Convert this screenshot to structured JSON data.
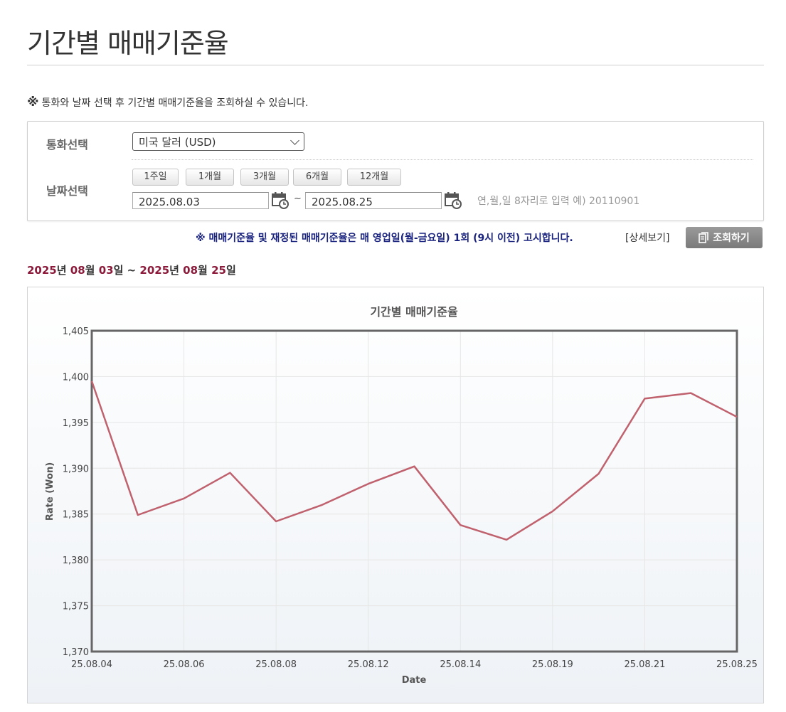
{
  "page": {
    "title": "기간별 매매기준율",
    "notice_mark": "※",
    "notice": "통화와 날짜 선택 후 기간별 매매기준율을 조회하실 수 있습니다."
  },
  "filter": {
    "currency_label": "통화선택",
    "currency_value": "미국 달러 (USD)",
    "date_label": "날짜선택",
    "period_buttons": [
      "1주일",
      "1개월",
      "3개월",
      "6개월",
      "12개월"
    ],
    "start_date": "2025.08.03",
    "end_date": "2025.08.25",
    "separator": "~",
    "date_hint": "연,월,일 8자리로 입력 예) 20110901"
  },
  "info": {
    "rate_notice": "※ 매매기준율 및 재정된 매매기준율은 매 영업일(월-금요일) 1회 (9시 이전) 고시합니다.",
    "detail_link": "[상세보기]",
    "search_button": "조회하기"
  },
  "range": {
    "y1": "2025",
    "u_year": "년 ",
    "m1": "08",
    "u_month": "월 ",
    "d1": "03",
    "u_day": "일",
    "sep": " ~ ",
    "y2": "2025",
    "m2": "08",
    "d2": "25"
  },
  "colors": {
    "line": "#c0616e",
    "accent": "#8b1a3a",
    "notice": "#1a237e"
  },
  "chart_data": {
    "type": "line",
    "title": "기간별 매매기준율",
    "xlabel": "Date",
    "ylabel": "Rate (Won)",
    "ylim": [
      1370,
      1405
    ],
    "yticks": [
      "1,370",
      "1,375",
      "1,380",
      "1,385",
      "1,390",
      "1,395",
      "1,400",
      "1,405"
    ],
    "x": [
      "25.08.04",
      "25.08.05",
      "25.08.06",
      "25.08.07",
      "25.08.08",
      "25.08.11",
      "25.08.12",
      "25.08.13",
      "25.08.14",
      "25.08.18",
      "25.08.19",
      "25.08.20",
      "25.08.21",
      "25.08.22",
      "25.08.25"
    ],
    "x_tick_labels": [
      "25.08.04",
      "25.08.06",
      "25.08.08",
      "25.08.12",
      "25.08.14",
      "25.08.19",
      "25.08.21",
      "25.08.25"
    ],
    "values": [
      1399.5,
      1384.9,
      1386.7,
      1389.5,
      1384.2,
      1386.0,
      1388.3,
      1390.2,
      1383.8,
      1382.2,
      1385.3,
      1389.4,
      1397.6,
      1398.2,
      1395.6
    ],
    "grid": true
  }
}
